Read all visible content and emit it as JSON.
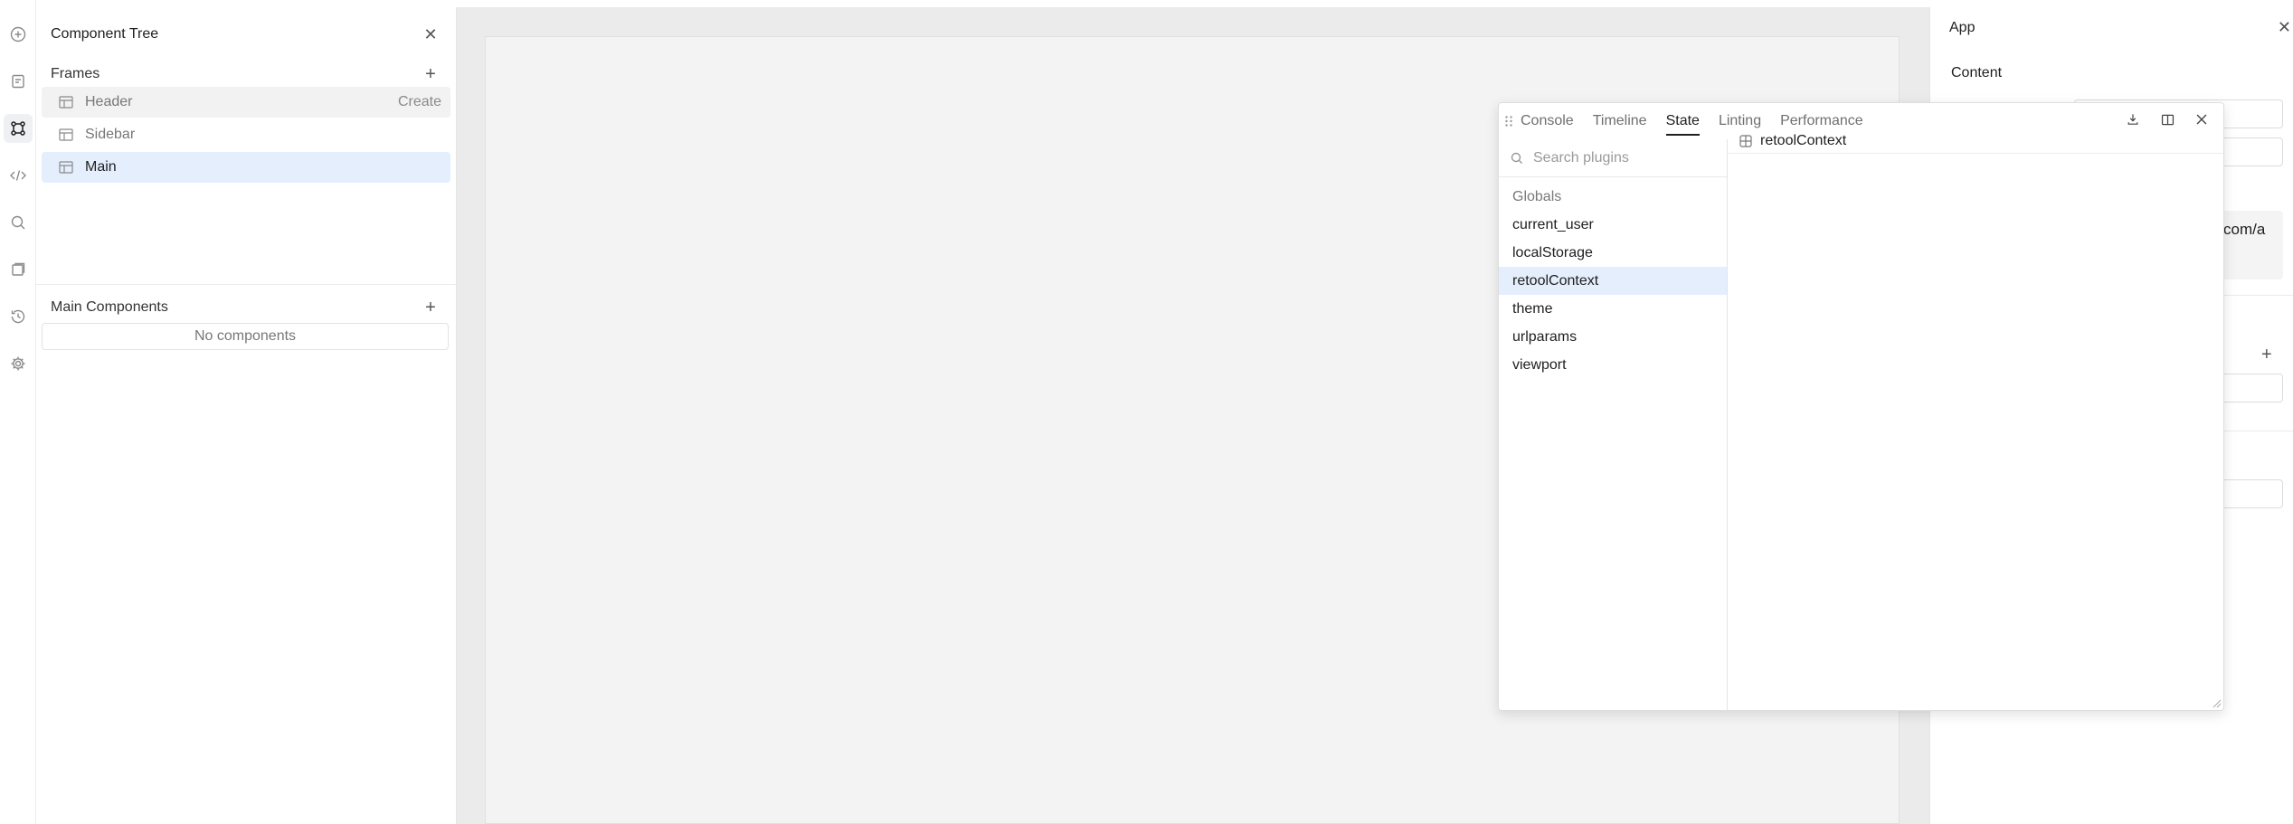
{
  "rail": {
    "icons": [
      "add-icon",
      "pages-icon",
      "component-tree-icon",
      "code-icon",
      "search-icon",
      "query-library-icon",
      "history-icon",
      "settings-icon"
    ]
  },
  "tree": {
    "title": "Component Tree",
    "frames_label": "Frames",
    "frames": [
      {
        "label": "Header",
        "action": "Create"
      },
      {
        "label": "Sidebar",
        "action": ""
      },
      {
        "label": "Main",
        "action": ""
      }
    ],
    "main_components_label": "Main Components",
    "no_components": "No components"
  },
  "inspector": {
    "title": "App",
    "content_label": "Content",
    "url_fragment": "com/a"
  },
  "debug": {
    "tabs": [
      "Console",
      "Timeline",
      "State",
      "Linting",
      "Performance"
    ],
    "active_tab": "State",
    "search_placeholder": "Search plugins",
    "group_label": "Globals",
    "items": [
      "current_user",
      "localStorage",
      "retoolContext",
      "theme",
      "urlparams",
      "viewport"
    ],
    "selected_item": "retoolContext",
    "detail_title": "retoolContext"
  },
  "colors": {
    "selected_bg": "#e4eefc",
    "canvas_bg": "#f3f3f3"
  }
}
